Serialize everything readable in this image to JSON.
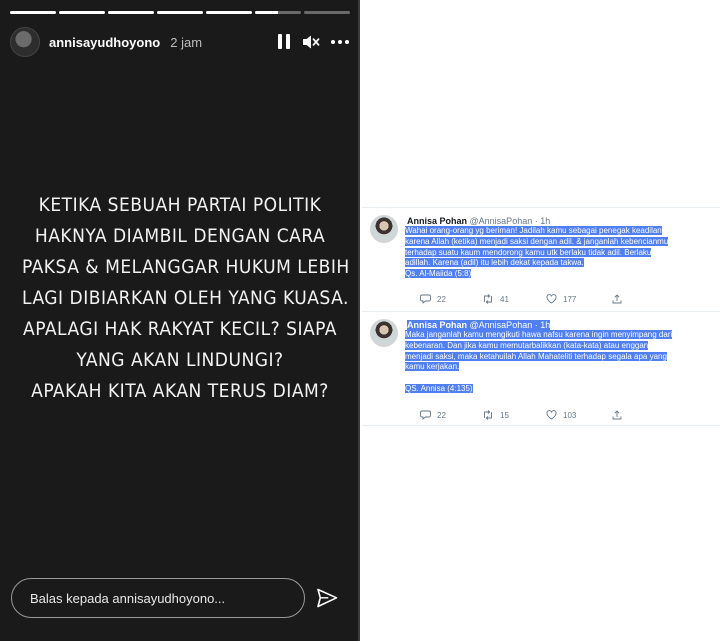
{
  "story": {
    "username": "annisayudhoyono",
    "time": "2 jam",
    "progress": [
      1,
      1,
      1,
      1,
      1,
      0.5,
      0
    ],
    "text_lines": [
      "KETIKA SEBUAH PARTAI POLITIK",
      "HAKNYA DIAMBIL DENGAN CARA",
      "PAKSA & MELANGGAR HUKUM LEBIH",
      "LAGI DIBIARKAN OLEH YANG KUASA.",
      "APALAGI HAK RAKYAT KECIL? SIAPA",
      "YANG AKAN LINDUNGI?",
      "APAKAH KITA AKAN TERUS DIAM?"
    ],
    "reply_placeholder": "Balas kepada annisayudhoyono...",
    "icons": {
      "pause": "pause-icon",
      "mute": "mute-icon",
      "more": "more-icon",
      "send": "send-icon"
    }
  },
  "tweets": [
    {
      "name": "Annisa Pohan",
      "handle": "@AnnisaPohan",
      "sep": " · ",
      "time": "1h",
      "body_lines": [
        "Wahai orang-orang yg beriman! Jadilah kamu sebagai penegak keadilan",
        "karena Allah (ketika) menjadi saksi dengan adil. & janganlah kebencianmu",
        "terhadap suatu kaum mendorong kamu utk berlaku tidak adil. Berlaku",
        "adillah. Karena (adil) itu lebih dekat kepada takwa.",
        "Qs. Al-Maiida (5:8)"
      ],
      "replies": "22",
      "retweets": "41",
      "likes": "177"
    },
    {
      "name": "Annisa Pohan",
      "handle": "@AnnisaPohan",
      "sep": " · ",
      "time": "1h",
      "body_lines": [
        "Maka janganlah kamu mengikuti hawa nafsu karena ingin menyimpang dari",
        "kebenaran. Dan jika kamu memutarbalikkan (kata-kata) atau enggan",
        "menjadi saksi, maka ketahuilah Allah Mahateliti terhadap segala apa yang",
        "kamu kerjakan.",
        "",
        "QS. Annisa (4:135)"
      ],
      "replies": "22",
      "retweets": "15",
      "likes": "103"
    }
  ],
  "colors": {
    "highlight": "#4f7ff0",
    "story_bg": "#1a1a1a",
    "twitter_gray": "#657786"
  }
}
